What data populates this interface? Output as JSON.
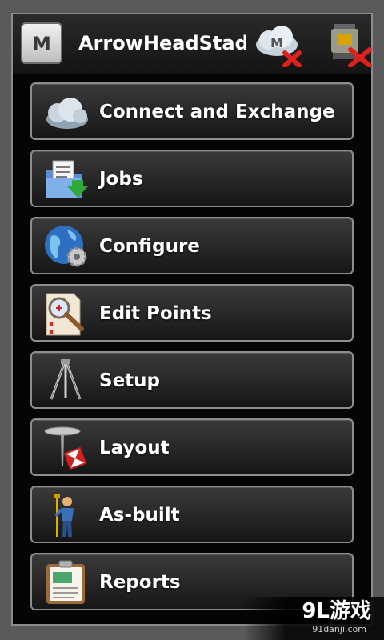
{
  "header": {
    "title": "ArrowHeadStad",
    "logo_letter": "M",
    "cloud_letter": "M"
  },
  "menu": [
    {
      "label": "Connect and Exchange",
      "icon": "cloud-icon"
    },
    {
      "label": "Jobs",
      "icon": "jobs-folder-icon"
    },
    {
      "label": "Configure",
      "icon": "globe-gear-icon"
    },
    {
      "label": "Edit Points",
      "icon": "magnifier-points-icon"
    },
    {
      "label": "Setup",
      "icon": "tripod-icon"
    },
    {
      "label": "Layout",
      "icon": "stake-icon"
    },
    {
      "label": "As-built",
      "icon": "surveyor-icon"
    },
    {
      "label": "Reports",
      "icon": "clipboard-icon"
    }
  ],
  "watermark": {
    "main": "9L游戏",
    "sub": "91danji.com"
  },
  "colors": {
    "background": "#5a5a5a",
    "panel": "#050505",
    "button_border": "#8d8d8d",
    "text": "#ffffff",
    "error_red": "#e0201c"
  }
}
